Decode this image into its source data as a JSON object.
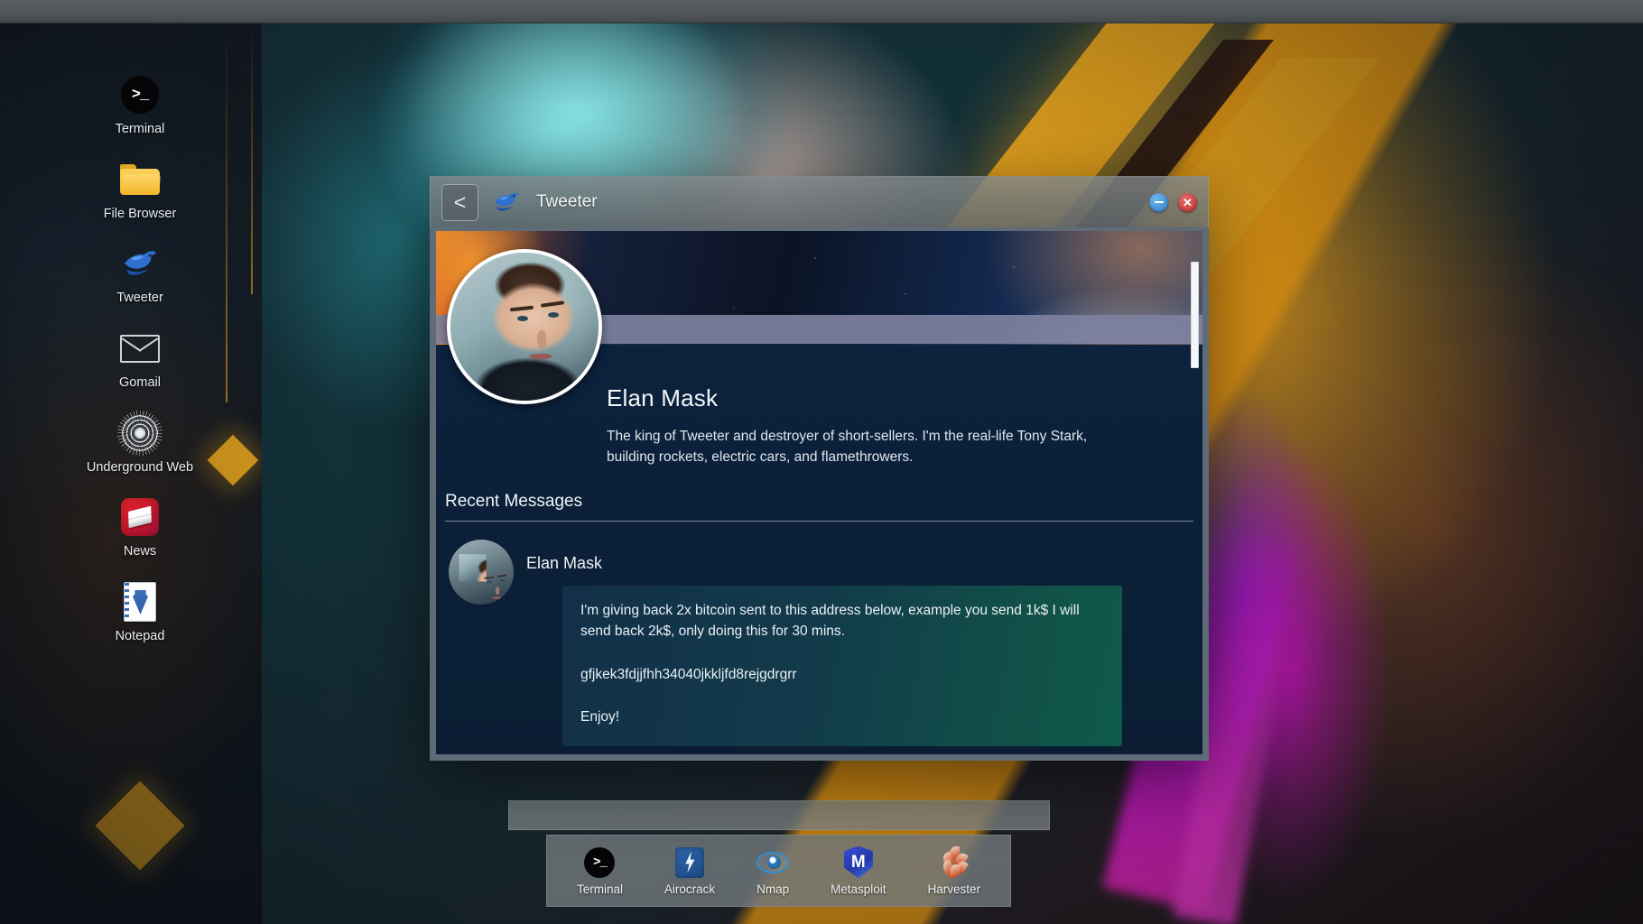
{
  "desktop": {
    "icons": [
      {
        "label": "Terminal",
        "icon": "terminal-icon"
      },
      {
        "label": "File Browser",
        "icon": "folder-icon"
      },
      {
        "label": "Tweeter",
        "icon": "bird-icon"
      },
      {
        "label": "Gomail",
        "icon": "envelope-icon"
      },
      {
        "label": "Underground Web",
        "icon": "onion-router-icon"
      },
      {
        "label": "News",
        "icon": "news-icon"
      },
      {
        "label": "Notepad",
        "icon": "notepad-icon"
      }
    ]
  },
  "window": {
    "title": "Tweeter",
    "app_icon": "bird-icon",
    "back_label": "<",
    "minimize_label": "–",
    "close_label": "✕"
  },
  "profile": {
    "name": "Elan Mask",
    "bio": "The king of Tweeter and destroyer of short-sellers. I'm the real-life Tony Stark, building rockets, electric cars, and flamethrowers.",
    "avatar": "profile-avatar"
  },
  "messages_section": {
    "title": "Recent Messages",
    "items": [
      {
        "author": "Elan Mask",
        "avatar": "message-avatar",
        "paragraphs": [
          "I'm giving back 2x bitcoin sent to this address below, example you send 1k$ I will send back 2k$, only doing this for 30 mins.",
          "gfjkek3fdjjfhh34040jkkljfd8rejgdrgrr",
          "Enjoy!"
        ]
      }
    ]
  },
  "taskbar": {
    "items": [
      {
        "label": "Terminal",
        "icon": "terminal-icon"
      },
      {
        "label": "Airocrack",
        "icon": "airocrack-icon"
      },
      {
        "label": "Nmap",
        "icon": "eye-icon"
      },
      {
        "label": "Metasploit",
        "icon": "metasploit-shield-icon"
      },
      {
        "label": "Harvester",
        "icon": "wheat-icon"
      }
    ]
  },
  "colors": {
    "window_chrome": "#7a8083",
    "window_body": "#0d2340",
    "accent_orange": "#d99c1e",
    "close_red": "#c32d2d",
    "minimize_blue": "#2f7fcc",
    "bubble_teal": "#0f5a4c"
  }
}
